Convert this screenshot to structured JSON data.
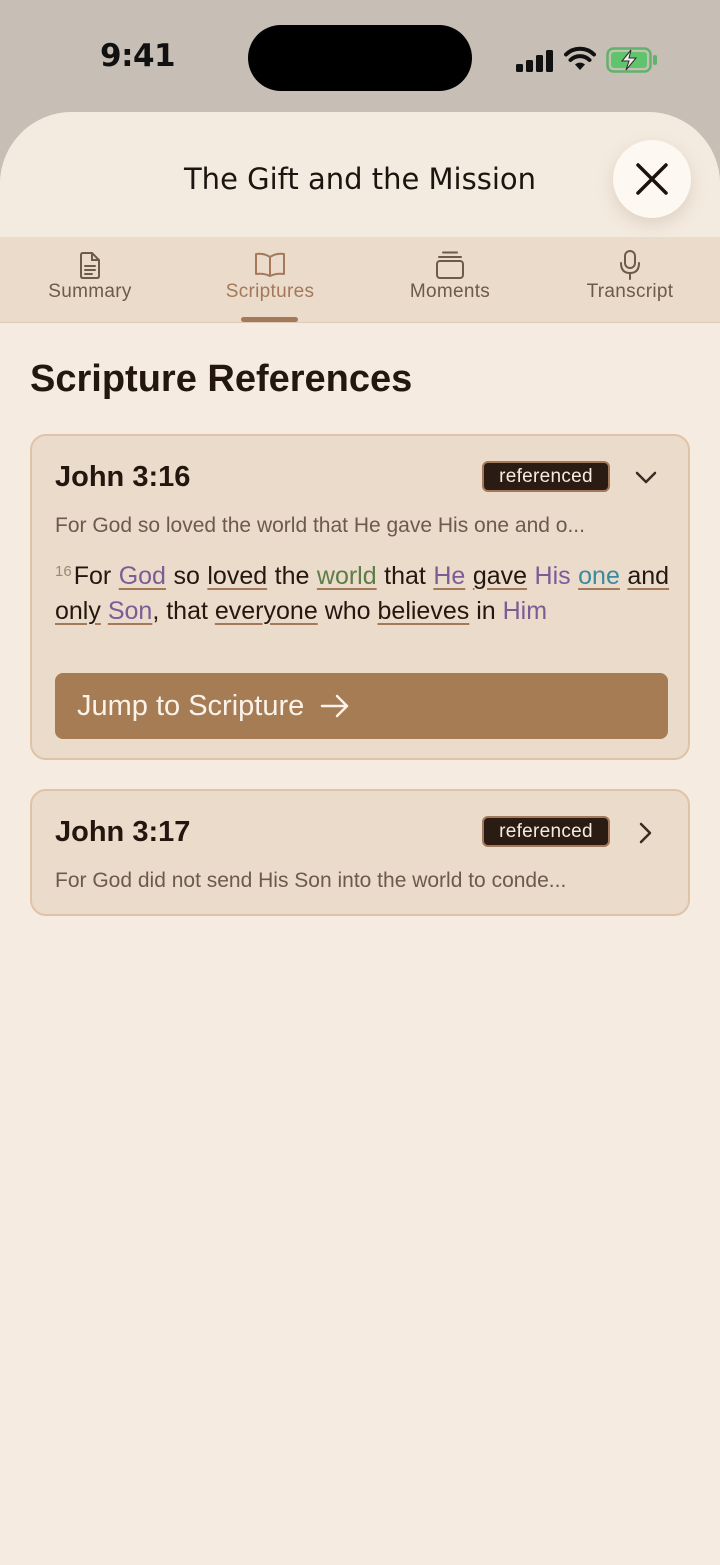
{
  "status_bar": {
    "time": "9:41"
  },
  "header": {
    "title": "The Gift and the Mission"
  },
  "tabs": [
    {
      "label": "Summary",
      "icon": "document-icon",
      "active": false
    },
    {
      "label": "Scriptures",
      "icon": "book-icon",
      "active": true
    },
    {
      "label": "Moments",
      "icon": "stack-icon",
      "active": false
    },
    {
      "label": "Transcript",
      "icon": "microphone-icon",
      "active": false
    }
  ],
  "section_title": "Scripture References",
  "cards": [
    {
      "reference": "John 3:16",
      "badge": "referenced",
      "expanded": true,
      "preview": "For God so loved the world that He gave His one and o...",
      "verse_number": "16",
      "verse_words": [
        "For",
        "God",
        "so",
        "loved",
        "the",
        "world",
        "that",
        "He",
        "gave",
        "His",
        "one",
        "and only",
        "Son",
        ",",
        "that",
        "everyone",
        "who",
        "believes",
        "in",
        "Him"
      ],
      "jump_label": "Jump to Scripture"
    },
    {
      "reference": "John 3:17",
      "badge": "referenced",
      "expanded": false,
      "preview": "For God did not send His Son into the world to conde..."
    }
  ],
  "colors": {
    "sheet_bg": "#f5ebe1",
    "card_bg": "#eadbcb",
    "accent": "#a3795a",
    "button": "#a57c54",
    "badge_bg": "#2a1c13"
  }
}
